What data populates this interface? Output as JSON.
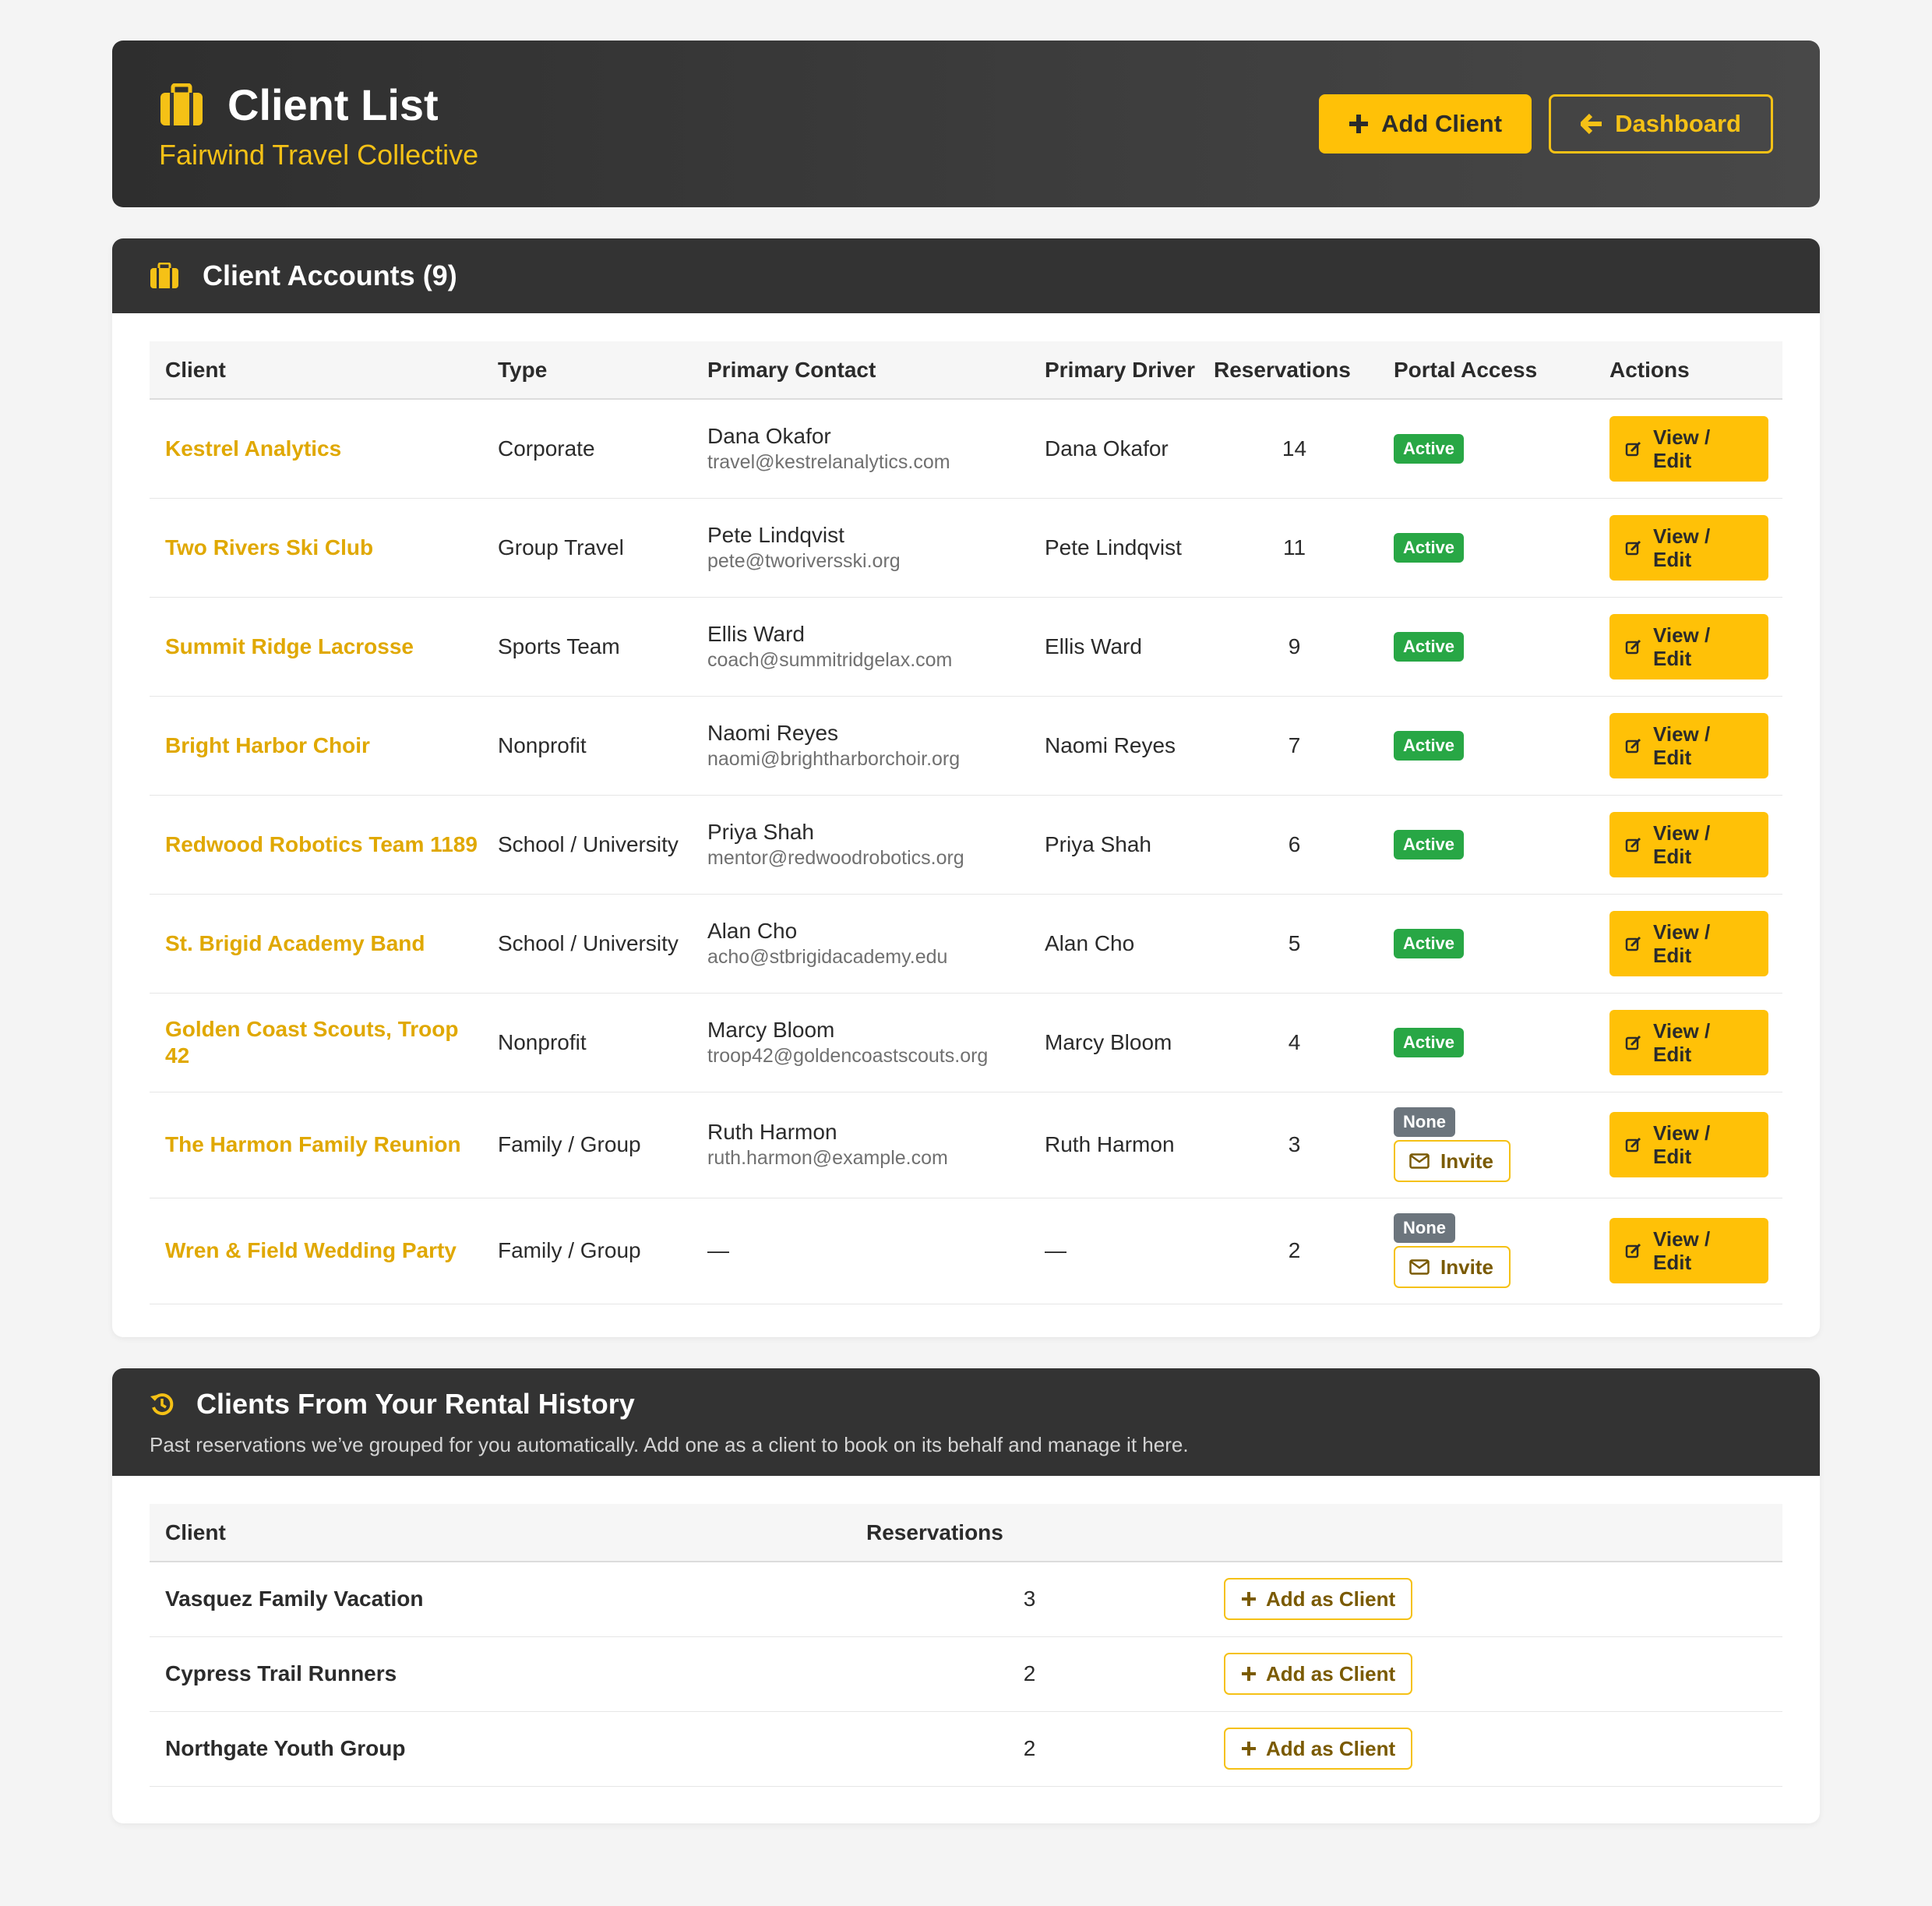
{
  "header": {
    "title": "Client List",
    "subtitle": "Fairwind Travel Collective",
    "add_client_label": "Add Client",
    "dashboard_label": "Dashboard",
    "icon": "briefcase-icon"
  },
  "colors": {
    "accent": "#ffc107",
    "header_bg": "#333333",
    "active_badge": "#28a745",
    "none_badge": "#6c757d"
  },
  "accounts": {
    "title": "Client Accounts (9)",
    "columns": [
      "Client",
      "Type",
      "Primary Contact",
      "Primary Driver",
      "Reservations",
      "Portal Access",
      "Actions"
    ],
    "view_edit_line1": "View /",
    "view_edit_line2": "Edit",
    "invite_label": "Invite",
    "rows": [
      {
        "client": "Kestrel Analytics",
        "type": "Corporate",
        "contact_name": "Dana Okafor",
        "contact_email": "travel@kestrelanalytics.com",
        "driver": "Dana Okafor",
        "reservations": "14",
        "portal": "Active"
      },
      {
        "client": "Two Rivers Ski Club",
        "type": "Group Travel",
        "contact_name": "Pete Lindqvist",
        "contact_email": "pete@tworiversski.org",
        "driver": "Pete Lindqvist",
        "reservations": "11",
        "portal": "Active"
      },
      {
        "client": "Summit Ridge Lacrosse",
        "type": "Sports Team",
        "contact_name": "Ellis Ward",
        "contact_email": "coach@summitridgelax.com",
        "driver": "Ellis Ward",
        "reservations": "9",
        "portal": "Active"
      },
      {
        "client": "Bright Harbor Choir",
        "type": "Nonprofit",
        "contact_name": "Naomi Reyes",
        "contact_email": "naomi@brightharborchoir.org",
        "driver": "Naomi Reyes",
        "reservations": "7",
        "portal": "Active"
      },
      {
        "client": "Redwood Robotics Team 1189",
        "type": "School / University",
        "contact_name": "Priya Shah",
        "contact_email": "mentor@redwoodrobotics.org",
        "driver": "Priya Shah",
        "reservations": "6",
        "portal": "Active"
      },
      {
        "client": "St. Brigid Academy Band",
        "type": "School / University",
        "contact_name": "Alan Cho",
        "contact_email": "acho@stbrigidacademy.edu",
        "driver": "Alan Cho",
        "reservations": "5",
        "portal": "Active"
      },
      {
        "client": "Golden Coast Scouts, Troop 42",
        "type": "Nonprofit",
        "contact_name": "Marcy Bloom",
        "contact_email": "troop42@goldencoastscouts.org",
        "driver": "Marcy Bloom",
        "reservations": "4",
        "portal": "Active"
      },
      {
        "client": "The Harmon Family Reunion",
        "type": "Family / Group",
        "contact_name": "Ruth Harmon",
        "contact_email": "ruth.harmon@example.com",
        "driver": "Ruth Harmon",
        "reservations": "3",
        "portal": "None"
      },
      {
        "client": "Wren & Field Wedding Party",
        "type": "Family / Group",
        "contact_name": "—",
        "contact_email": "",
        "driver": "—",
        "reservations": "2",
        "portal": "None"
      }
    ]
  },
  "history": {
    "title": "Clients From Your Rental History",
    "subtitle": "Past reservations we’ve grouped for you automatically. Add one as a client to book on its behalf and manage it here.",
    "columns": [
      "Client",
      "Reservations"
    ],
    "add_label": "Add as Client",
    "rows": [
      {
        "client": "Vasquez Family Vacation",
        "reservations": "3"
      },
      {
        "client": "Cypress Trail Runners",
        "reservations": "2"
      },
      {
        "client": "Northgate Youth Group",
        "reservations": "2"
      }
    ]
  }
}
